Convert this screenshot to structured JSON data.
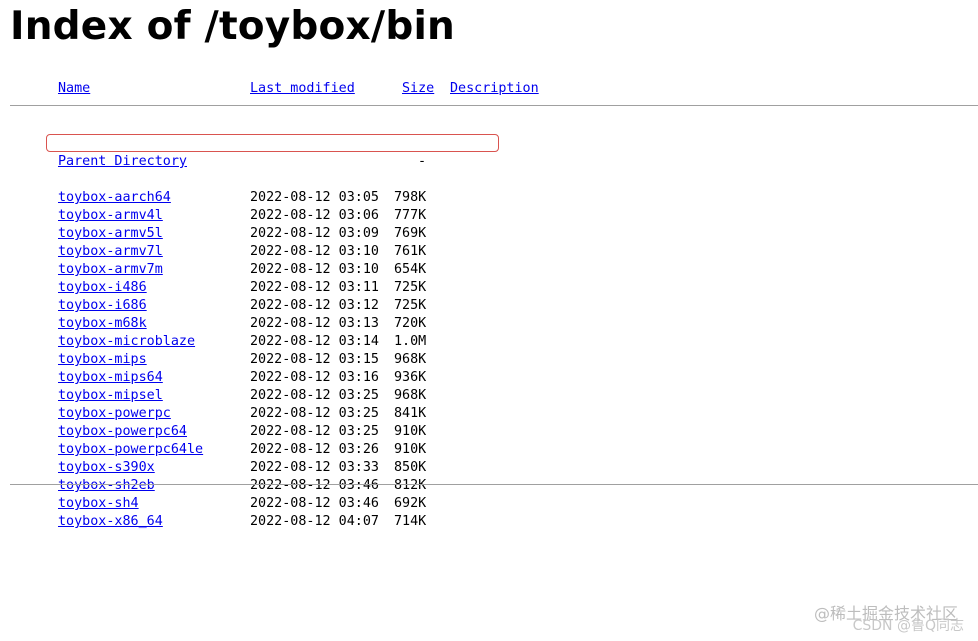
{
  "page": {
    "title": "Index of /toybox/bin"
  },
  "columns": {
    "name": "Name",
    "last_modified": "Last modified",
    "size": "Size",
    "description": "Description"
  },
  "parent": {
    "label": "Parent Directory",
    "size": "-"
  },
  "rows": [
    {
      "name": "toybox-aarch64",
      "date": "2022-08-12 03:05",
      "size": "798K"
    },
    {
      "name": "toybox-armv4l",
      "date": "2022-08-12 03:06",
      "size": "777K"
    },
    {
      "name": "toybox-armv5l",
      "date": "2022-08-12 03:09",
      "size": "769K"
    },
    {
      "name": "toybox-armv7l",
      "date": "2022-08-12 03:10",
      "size": "761K"
    },
    {
      "name": "toybox-armv7m",
      "date": "2022-08-12 03:10",
      "size": "654K"
    },
    {
      "name": "toybox-i486",
      "date": "2022-08-12 03:11",
      "size": "725K"
    },
    {
      "name": "toybox-i686",
      "date": "2022-08-12 03:12",
      "size": "725K"
    },
    {
      "name": "toybox-m68k",
      "date": "2022-08-12 03:13",
      "size": "720K"
    },
    {
      "name": "toybox-microblaze",
      "date": "2022-08-12 03:14",
      "size": "1.0M"
    },
    {
      "name": "toybox-mips",
      "date": "2022-08-12 03:15",
      "size": "968K"
    },
    {
      "name": "toybox-mips64",
      "date": "2022-08-12 03:16",
      "size": "936K"
    },
    {
      "name": "toybox-mipsel",
      "date": "2022-08-12 03:25",
      "size": "968K"
    },
    {
      "name": "toybox-powerpc",
      "date": "2022-08-12 03:25",
      "size": "841K"
    },
    {
      "name": "toybox-powerpc64",
      "date": "2022-08-12 03:25",
      "size": "910K"
    },
    {
      "name": "toybox-powerpc64le",
      "date": "2022-08-12 03:26",
      "size": "910K"
    },
    {
      "name": "toybox-s390x",
      "date": "2022-08-12 03:33",
      "size": "850K"
    },
    {
      "name": "toybox-sh2eb",
      "date": "2022-08-12 03:46",
      "size": "812K"
    },
    {
      "name": "toybox-sh4",
      "date": "2022-08-12 03:46",
      "size": "692K"
    },
    {
      "name": "toybox-x86_64",
      "date": "2022-08-12 04:07",
      "size": "714K"
    }
  ],
  "highlight_row": "toybox-aarch64",
  "watermark": {
    "line1": "@稀土掘金技术社区",
    "line2": "CSDN @鲁Q同志"
  },
  "colors": {
    "link": "#0000ee",
    "highlight_border": "#d9534f",
    "rule": "#a0a0a0"
  }
}
